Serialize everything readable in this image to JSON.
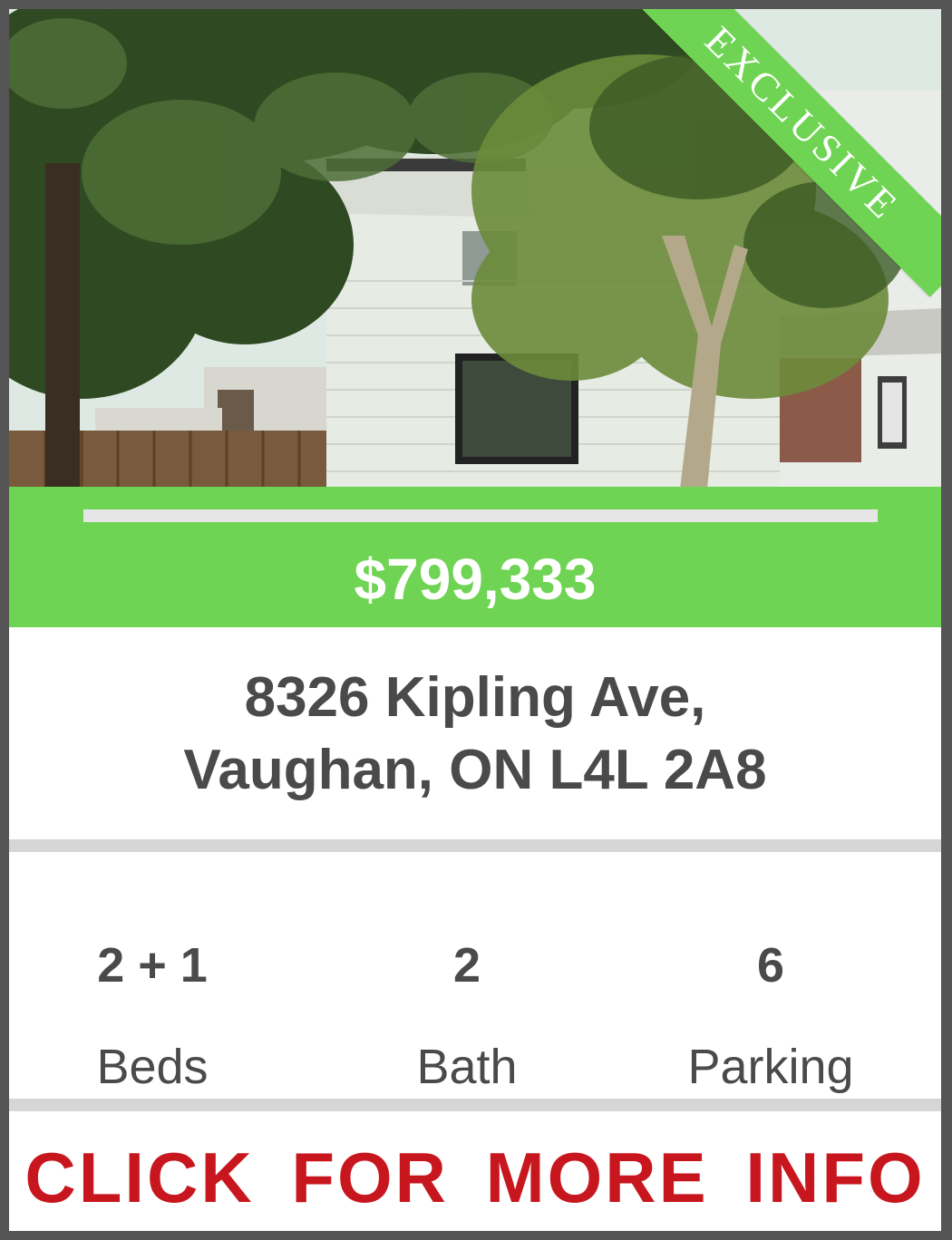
{
  "listing": {
    "badge": "EXCLUSIVE",
    "price": "$799,333",
    "address_line1": "8326 Kipling Ave,",
    "address_line2": "Vaughan, ON L4L 2A8"
  },
  "stats": [
    {
      "value": "2 + 1",
      "label": "Beds"
    },
    {
      "value": "2",
      "label": "Bath"
    },
    {
      "value": "6",
      "label": "Parking"
    }
  ],
  "cta": {
    "label": "CLICK FOR MORE INFO"
  },
  "colors": {
    "accent_green": "#6fd453",
    "cta_red": "#c8161e",
    "text_gray": "#4a4a4a",
    "frame": "#555555",
    "divider": "#d6d6d6"
  }
}
